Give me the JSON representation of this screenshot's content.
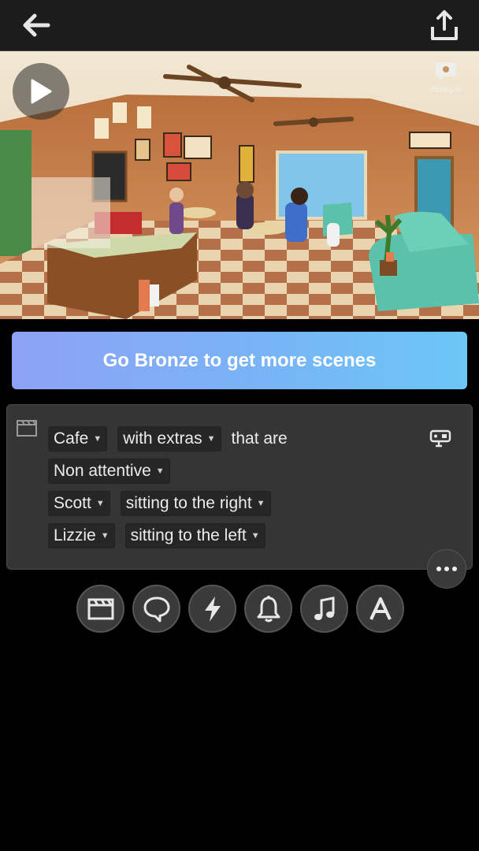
{
  "topbar": {
    "back_icon": "arrow-left-icon",
    "share_icon": "share-upload-icon"
  },
  "preview": {
    "play_icon": "play-icon",
    "watermark": "Plotagon"
  },
  "upgrade": {
    "label": "Go Bronze to get more scenes"
  },
  "scene": {
    "clap_icon": "clapperboard-icon",
    "camera_icon": "camera-icon",
    "location": "Cafe",
    "extras": "with extras",
    "that_are": "that are",
    "attentiveness": "Non attentive",
    "char1": {
      "name": "Scott",
      "position": "sitting to the right"
    },
    "char2": {
      "name": "Lizzie",
      "position": "sitting to the left"
    }
  },
  "more_icon": "more-horizontal-icon",
  "toolbar": [
    {
      "name": "scene",
      "icon": "clapperboard-icon"
    },
    {
      "name": "dialogue",
      "icon": "speech-bubble-icon"
    },
    {
      "name": "action",
      "icon": "lightning-icon"
    },
    {
      "name": "sound-effect",
      "icon": "bell-icon"
    },
    {
      "name": "music",
      "icon": "music-note-icon"
    },
    {
      "name": "text",
      "icon": "text-a-icon"
    }
  ],
  "colors": {
    "banner_start": "#8ea2f5",
    "banner_end": "#6cc6f6",
    "card_bg": "#353535"
  }
}
